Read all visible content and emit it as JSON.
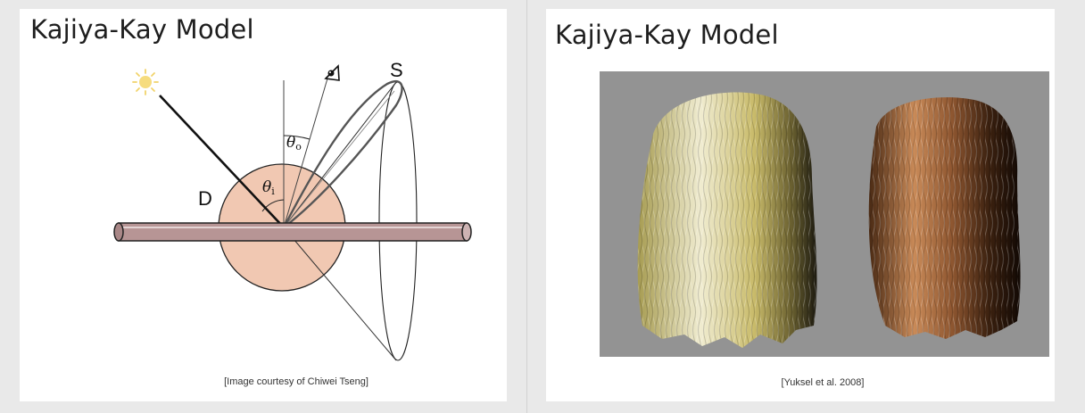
{
  "left_slide": {
    "title": "Kajiya-Kay Model",
    "caption": "[Image courtesy of Chiwei Tseng]",
    "diagram": {
      "label_D": "D",
      "label_S": "S",
      "theta_i": "θ",
      "theta_i_sub": "i",
      "theta_o": "θ",
      "theta_o_sub": "o",
      "icons": [
        "sun-icon",
        "eye-icon"
      ],
      "colors": {
        "sphere": "#f1c8b2",
        "cylinder": "#b79595",
        "line": "#000000"
      }
    }
  },
  "right_slide": {
    "title": "Kajiya-Kay Model",
    "caption": "[Yuksel et al. 2008]",
    "image": {
      "subjects": [
        "blonde-hair",
        "brown-hair"
      ],
      "background": "#939393"
    }
  }
}
